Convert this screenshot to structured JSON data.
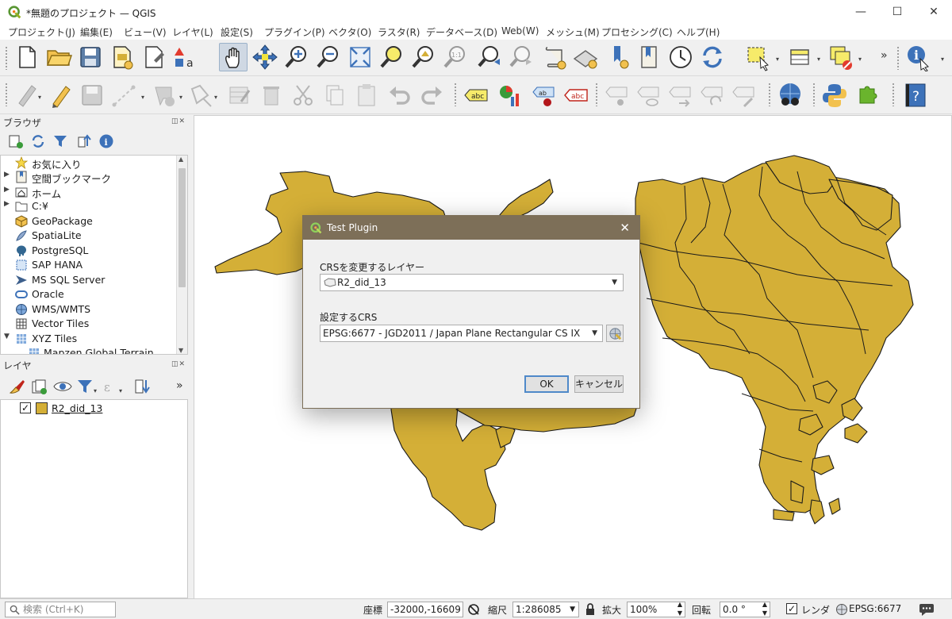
{
  "window": {
    "title": "*無題のプロジェクト — QGIS",
    "minimize_glyph": "—",
    "maximize_glyph": "☐",
    "close_glyph": "✕"
  },
  "menubar": [
    "プロジェクト(J)",
    "編集(E)",
    "ビュー(V)",
    "レイヤ(L)",
    "設定(S)",
    "プラグイン(P)",
    "ベクタ(O)",
    "ラスタ(R)",
    "データベース(D)",
    "Web(W)",
    "メッシュ(M)",
    "プロセシング(C)",
    "ヘルプ(H)"
  ],
  "toolbar": {
    "row1_icons": [
      "new-project-icon",
      "open-project-icon",
      "save-project-icon",
      "print-layout-icon",
      "layout-manager-icon",
      "style-manager-icon",
      "pan-icon",
      "pan-to-selection-icon",
      "zoom-in-icon",
      "zoom-out-icon",
      "zoom-full-icon",
      "zoom-to-selection-icon",
      "zoom-to-layer-icon",
      "zoom-native-icon",
      "zoom-last-icon",
      "zoom-next-icon",
      "new-map-view-icon",
      "new-3d-view-icon",
      "new-bookmark-icon",
      "show-bookmarks-icon",
      "temporal-controller-icon",
      "refresh-icon",
      "select-features-icon",
      "attribute-table-icon",
      "deselect-icon",
      "identify-icon"
    ],
    "row2_icons": [
      "digitize-icon",
      "toggle-editing-icon",
      "save-edits-icon",
      "add-feature-icon",
      "move-feature-icon",
      "vertex-tool-icon",
      "modify-attributes-icon",
      "delete-selected-icon",
      "cut-icon",
      "copy-icon",
      "paste-icon",
      "undo-icon",
      "redo-icon",
      "label-toolbar-icon",
      "diagram-icon",
      "label-highlight-icon",
      "label-pin-icon",
      "label-show-hide-icon",
      "label-move-icon",
      "label-rotate-icon",
      "label-change-icon",
      "metasearch-icon",
      "python-console-icon",
      "plugins-icon",
      "help-icon"
    ],
    "label_badge": "abc",
    "more_glyph": "»",
    "help_glyph": "?"
  },
  "browser_panel": {
    "title": "ブラウザ",
    "controls": "◫✕",
    "items": [
      {
        "label": "お気に入り",
        "icon": "star-icon",
        "expandable": false
      },
      {
        "label": "空間ブックマーク",
        "icon": "bookmark-icon",
        "expandable": true
      },
      {
        "label": "ホーム",
        "icon": "home-folder-icon",
        "expandable": true
      },
      {
        "label": "C:¥",
        "icon": "drive-folder-icon",
        "expandable": true
      },
      {
        "label": "GeoPackage",
        "icon": "geopackage-icon",
        "expandable": false
      },
      {
        "label": "SpatiaLite",
        "icon": "spatialite-icon",
        "expandable": false
      },
      {
        "label": "PostgreSQL",
        "icon": "postgresql-icon",
        "expandable": false
      },
      {
        "label": "SAP HANA",
        "icon": "sap-hana-icon",
        "expandable": false
      },
      {
        "label": "MS SQL Server",
        "icon": "mssql-icon",
        "expandable": false
      },
      {
        "label": "Oracle",
        "icon": "oracle-icon",
        "expandable": false
      },
      {
        "label": "WMS/WMTS",
        "icon": "wms-icon",
        "expandable": false
      },
      {
        "label": "Vector Tiles",
        "icon": "vector-tiles-icon",
        "expandable": false
      },
      {
        "label": "XYZ Tiles",
        "icon": "xyz-tiles-icon",
        "expandable": true,
        "expanded": true
      },
      {
        "label": "Mapzen Global Terrain",
        "icon": "xyz-tiles-icon",
        "expandable": false,
        "child": true
      }
    ]
  },
  "layers_panel": {
    "title": "レイヤ",
    "controls": "◫✕",
    "more_glyph": "»",
    "layers": [
      {
        "name": "R2_did_13",
        "visible": true,
        "checkmark": "✓",
        "fill": "#d4af37"
      }
    ]
  },
  "map": {
    "fill": "#d4af37",
    "stroke": "#1a1a1a",
    "background": "#ffffff"
  },
  "dialog": {
    "title": "Test Plugin",
    "close_glyph": "✕",
    "layer_label": "CRSを変更するレイヤー",
    "layer_value": "R2_did_13",
    "crs_label": "設定するCRS",
    "crs_value": "EPSG:6677 - JGD2011 / Japan Plane Rectangular CS IX",
    "ok_label": "OK",
    "cancel_label": "キャンセル"
  },
  "statusbar": {
    "search_placeholder": "検索 (Ctrl+K)",
    "coord_label": "座標",
    "coord_value": "-32000,-16609",
    "scale_label": "縮尺",
    "scale_value": "1:286085",
    "magnifier_label": "拡大",
    "magnifier_value": "100%",
    "rotation_label": "回転",
    "rotation_value": "0.0 °",
    "render_label": "レンダ",
    "render_checked": true,
    "render_checkmark": "✓",
    "crs_value": "EPSG:6677"
  }
}
